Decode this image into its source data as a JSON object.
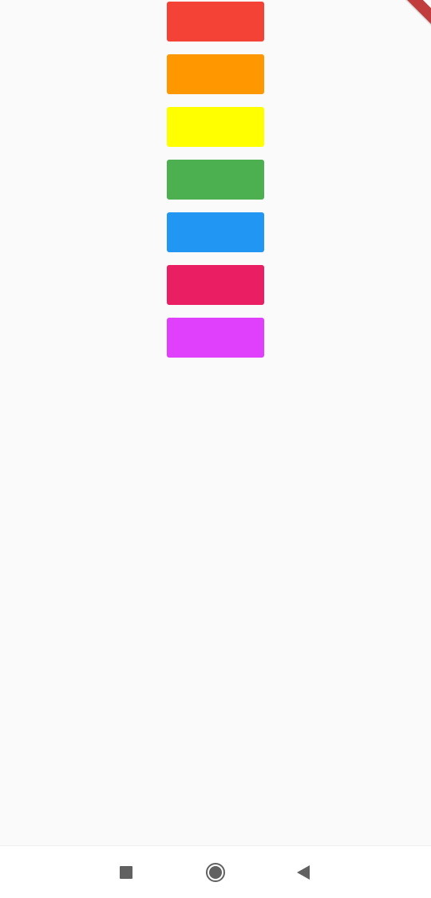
{
  "tiles": [
    {
      "name": "red",
      "color": "#f44336"
    },
    {
      "name": "orange",
      "color": "#ff9800"
    },
    {
      "name": "yellow",
      "color": "#ffff00"
    },
    {
      "name": "green",
      "color": "#4caf50"
    },
    {
      "name": "blue",
      "color": "#2196f3"
    },
    {
      "name": "pink",
      "color": "#e91e63"
    },
    {
      "name": "magenta",
      "color": "#e040fb"
    }
  ],
  "debug_banner": {
    "color": "#b71c1c"
  },
  "nav_bar": {
    "icons": [
      "recents-square-icon",
      "home-circle-icon",
      "back-triangle-icon"
    ],
    "icon_color": "#616161"
  }
}
